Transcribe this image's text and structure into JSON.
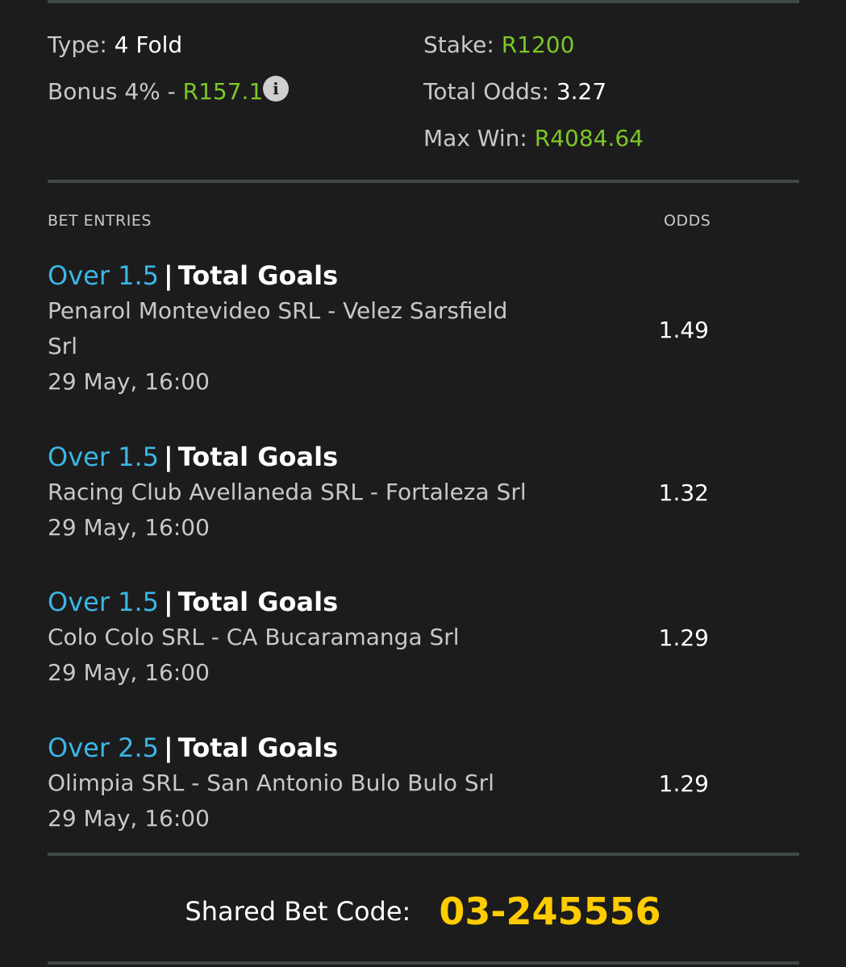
{
  "summary": {
    "type_label": "Type:",
    "type_value": "4 Fold",
    "bonus_label": "Bonus 4% -",
    "bonus_value": "R157.1",
    "info_icon": "info-icon",
    "stake_label": "Stake:",
    "stake_value": "R1200",
    "total_odds_label": "Total Odds:",
    "total_odds_value": "3.27",
    "max_win_label": "Max Win:",
    "max_win_value": "R4084.64"
  },
  "headers": {
    "entries": "BET ENTRIES",
    "odds": "ODDS"
  },
  "entries": [
    {
      "selection": "Over 1.5",
      "separator": "|",
      "market": "Total Goals",
      "teams": "Penarol Montevideo SRL - Velez Sarsfield Srl",
      "time": "29 May, 16:00",
      "odds": "1.49"
    },
    {
      "selection": "Over 1.5",
      "separator": "|",
      "market": "Total Goals",
      "teams": "Racing Club Avellaneda SRL - Fortaleza Srl",
      "time": "29 May, 16:00",
      "odds": "1.32"
    },
    {
      "selection": "Over 1.5",
      "separator": "|",
      "market": "Total Goals",
      "teams": "Colo Colo SRL - CA Bucaramanga Srl",
      "time": "29 May, 16:00",
      "odds": "1.29"
    },
    {
      "selection": "Over 2.5",
      "separator": "|",
      "market": "Total Goals",
      "teams": "Olimpia SRL - San Antonio Bulo Bulo Srl",
      "time": "29 May, 16:00",
      "odds": "1.29"
    }
  ],
  "shared": {
    "label": "Shared Bet Code:",
    "code": "03-245556"
  },
  "colors": {
    "background": "#1c1c1c",
    "accent_green": "#7dc728",
    "selection_blue": "#3bb6e6",
    "code_yellow": "#ffcc00",
    "divider": "#424849"
  }
}
